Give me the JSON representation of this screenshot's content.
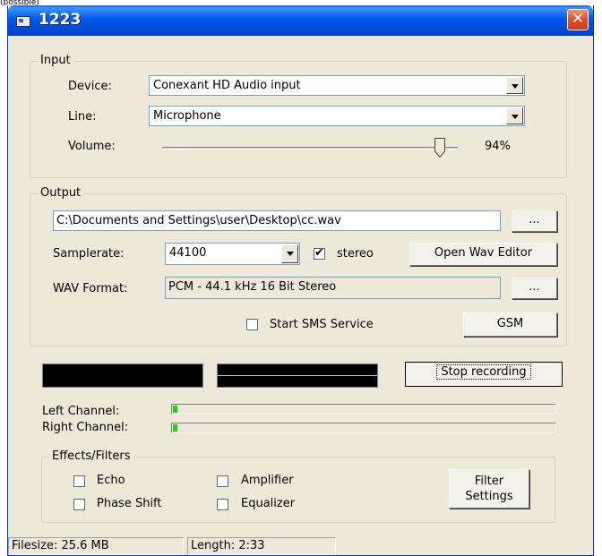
{
  "caption_fragment": "(possible)",
  "window": {
    "title": "1223",
    "close_glyph": "✕"
  },
  "input": {
    "legend": "Input",
    "device_label": "Device:",
    "device_value": "Conexant HD Audio input",
    "line_label": "Line:",
    "line_value": "Microphone",
    "volume_label": "Volume:",
    "volume_level": 0.94,
    "volume_text": "94%"
  },
  "output": {
    "legend": "Output",
    "file_path": "C:\\Documents and Settings\\user\\Desktop\\cc.wav",
    "browse_label": "...",
    "samplerate_label": "Samplerate:",
    "samplerate_value": "44100",
    "stereo_label": "stereo",
    "stereo_checked": true,
    "open_editor_label": "Open Wav Editor",
    "wav_format_label": "WAV Format:",
    "wav_format_value": "PCM - 44.1 kHz 16 Bit Stereo",
    "format_browse_label": "...",
    "sms_label": "Start SMS Service",
    "sms_checked": false,
    "gsm_label": "GSM"
  },
  "recording": {
    "stop_label": "Stop recording"
  },
  "channels": {
    "left_label": "Left Channel:",
    "right_label": "Right Channel:",
    "left_level": 0.01,
    "right_level": 0.01,
    "fill_color": "#22d022"
  },
  "effects": {
    "legend": "Effects/Filters",
    "echo_label": "Echo",
    "amplifier_label": "Amplifier",
    "phase_shift_label": "Phase Shift",
    "equalizer_label": "Equalizer",
    "filter_settings_line1": "Filter",
    "filter_settings_line2": "Settings"
  },
  "status": {
    "filesize": "Filesize: 25.6 MB",
    "length": "Length: 2:33"
  },
  "colors": {
    "title_bar": "#0058ee",
    "window_bg": "#ece9d8",
    "close_button": "#e0502a"
  }
}
